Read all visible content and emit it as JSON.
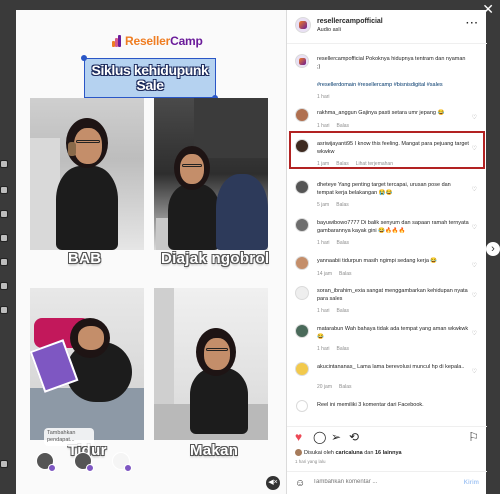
{
  "media": {
    "brand_name_a": "Reseller",
    "brand_name_b": "Camp",
    "title": "Siklus kehidupunk Sale",
    "captions": [
      "BAB",
      "Diajak ngobrol",
      "Tidur",
      "Makan"
    ],
    "tag_bubble": "Tambahkan pendapat..."
  },
  "header": {
    "username": "resellercampofficial",
    "audio": "Audio asli",
    "more": "···"
  },
  "post": {
    "username": "resellercampofficial",
    "text": "Pokoknya hidupnya tentram dan nyaman ;)",
    "hashtags": "#resellerdomain #resellercamp #bisnisdigital #sales",
    "age": "1 hari"
  },
  "comments": [
    {
      "user": "rakhma_anggun",
      "text": "Gajinya pasti setara umr jepang 😂",
      "age": "1 hari",
      "reply": "Balas",
      "extra": ""
    },
    {
      "user": "asriwijayanti95",
      "text": "I know this feeling. Mangat para pejuang target wkwkw",
      "age": "1 jam",
      "reply": "Balas",
      "extra": "Lihat terjemahan"
    },
    {
      "user": "dheteye",
      "text": "Yang penting target tercapai, urusan pose dan tempat kerja belakangan 😭😂",
      "age": "5 jam",
      "reply": "Balas",
      "extra": ""
    },
    {
      "user": "bayuwibowo7777",
      "text": "Di balik senyum dan sapaan ramah ternyata gambarannya kayak gini 😂🔥🔥🔥",
      "age": "1 hari",
      "reply": "Balas",
      "extra": ""
    },
    {
      "user": "yannaabii",
      "text": "tidurpun masih ngimpi sedang kerja 😂",
      "age": "14 jam",
      "reply": "Balas",
      "extra": ""
    },
    {
      "user": "soran_ibrahim_exia",
      "text": "sangat menggambarkan kehidupan nyata para sales",
      "age": "1 hari",
      "reply": "Balas",
      "extra": ""
    },
    {
      "user": "matarabun",
      "text": "Wah bahaya tidak ada tempat yang aman wkwkwk 😂",
      "age": "1 hari",
      "reply": "Balas",
      "extra": ""
    },
    {
      "user": "akucintananas_",
      "text": "Lama lama berevolusi muncul hp di kepala..",
      "age": "20 jam",
      "reply": "Balas",
      "extra": ""
    }
  ],
  "facebook_note": "Reel ini memiliki 3 komentar dari Facebook.",
  "likes": {
    "prefix": "Disukai oleh",
    "user": "caricaluna",
    "mid": "dan",
    "count": "16 lainnya",
    "age": "1 hari yang lalu"
  },
  "composer": {
    "placeholder": "Tambahkan komentar ...",
    "post_label": "Kirim"
  },
  "icons": {
    "heart": "heart-icon",
    "comment": "comment-icon",
    "share": "share-icon",
    "save": "bookmark-icon",
    "emoji": "emoji-icon"
  },
  "colors": {
    "accent_orange": "#ef7d22",
    "accent_purple": "#6a1b9a",
    "like_red": "#ed4956",
    "highlight": "#b22222",
    "link": "#00376b"
  }
}
